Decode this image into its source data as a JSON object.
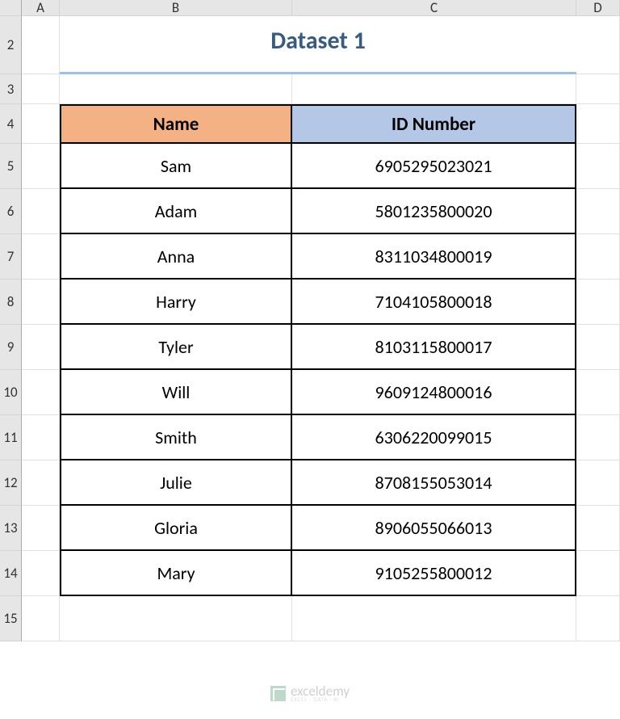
{
  "columns": [
    "",
    "A",
    "B",
    "C",
    "D"
  ],
  "rows": [
    "",
    "2",
    "3",
    "4",
    "5",
    "6",
    "7",
    "8",
    "9",
    "10",
    "11",
    "12",
    "13",
    "14",
    "15"
  ],
  "title": "Dataset 1",
  "headers": {
    "name": "Name",
    "id": "ID Number"
  },
  "data": [
    {
      "name": "Sam",
      "id": "6905295023021"
    },
    {
      "name": "Adam",
      "id": "5801235800020"
    },
    {
      "name": "Anna",
      "id": "8311034800019"
    },
    {
      "name": "Harry",
      "id": "7104105800018"
    },
    {
      "name": "Tyler",
      "id": "8103115800017"
    },
    {
      "name": "Will",
      "id": "9609124800016"
    },
    {
      "name": "Smith",
      "id": "6306220099015"
    },
    {
      "name": "Julie",
      "id": "8708155053014"
    },
    {
      "name": "Gloria",
      "id": "8906055066013"
    },
    {
      "name": "Mary",
      "id": "9105255800012"
    }
  ],
  "watermark": {
    "text": "exceldemy",
    "sub": "EXCEL · DATA · BI"
  },
  "colors": {
    "title": "#375b81",
    "titleUnderline": "#9bc2e6",
    "headerName": "#f4b183",
    "headerId": "#b4c7e7"
  }
}
